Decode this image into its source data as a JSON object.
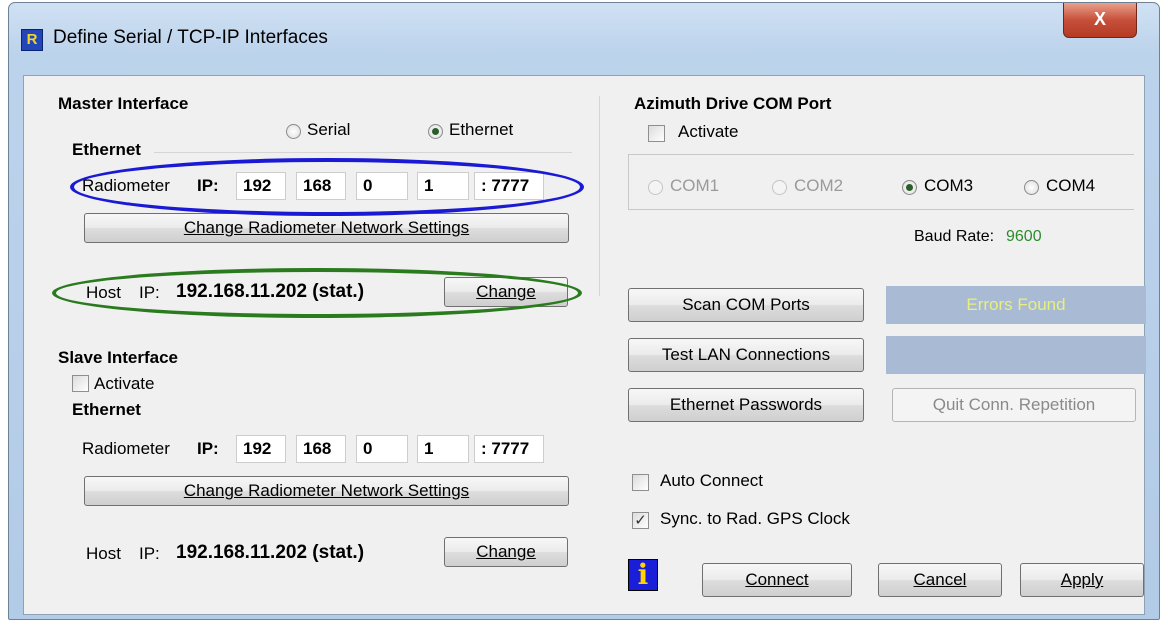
{
  "window": {
    "title": "Define Serial / TCP-IP Interfaces",
    "icon": "app-logo-icon",
    "close_label": "X",
    "close_icon": "close-icon"
  },
  "master": {
    "heading": "Master Interface",
    "mode_serial": "Serial",
    "mode_ethernet": "Ethernet",
    "mode_selected": "Ethernet",
    "sub_heading": "Ethernet",
    "radiometer_label": "Radiometer",
    "ip_label": "IP:",
    "ip": [
      "192",
      "168",
      "0",
      "1"
    ],
    "port": ": 7777",
    "change_net_button": "Change Radiometer Network Settings",
    "host_label": "Host",
    "host_ip_label": "IP:",
    "host_ip": "192.168.11.202 (stat.)",
    "change_button": "Change"
  },
  "slave": {
    "heading": "Slave Interface",
    "activate_label": "Activate",
    "activate_checked": false,
    "sub_heading": "Ethernet",
    "radiometer_label": "Radiometer",
    "ip_label": "IP:",
    "ip": [
      "192",
      "168",
      "0",
      "1"
    ],
    "port": ": 7777",
    "change_net_button": "Change Radiometer Network Settings",
    "host_label": "Host",
    "host_ip_label": "IP:",
    "host_ip": "192.168.11.202 (stat.)",
    "change_button": "Change"
  },
  "azimuth": {
    "heading": "Azimuth Drive COM Port",
    "activate_label": "Activate",
    "activate_checked": false,
    "ports": [
      "COM1",
      "COM2",
      "COM3",
      "COM4"
    ],
    "selected_port": "COM3",
    "baud_label": "Baud Rate:",
    "baud_value": "9600"
  },
  "actions": {
    "scan_button": "Scan COM Ports",
    "scan_status": "Errors Found",
    "test_lan_button": "Test LAN Connections",
    "test_lan_status": "",
    "ethernet_passwords_button": "Ethernet Passwords",
    "quit_repetition_button": "Quit Conn. Repetition"
  },
  "options": {
    "auto_connect_label": "Auto Connect",
    "auto_connect_checked": false,
    "sync_gps_label": "Sync. to Rad. GPS Clock",
    "sync_gps_checked": true
  },
  "footer": {
    "info_icon": "info-icon",
    "info_glyph": "i",
    "connect_button": "Connect",
    "cancel_button": "Cancel",
    "apply_button": "Apply"
  },
  "colors": {
    "annotation_blue": "#1a1ad4",
    "annotation_green": "#2a7a1e",
    "status_bg": "#a9bad5",
    "status_text": "#e8f07b",
    "baud_value": "#2e8b2e"
  }
}
